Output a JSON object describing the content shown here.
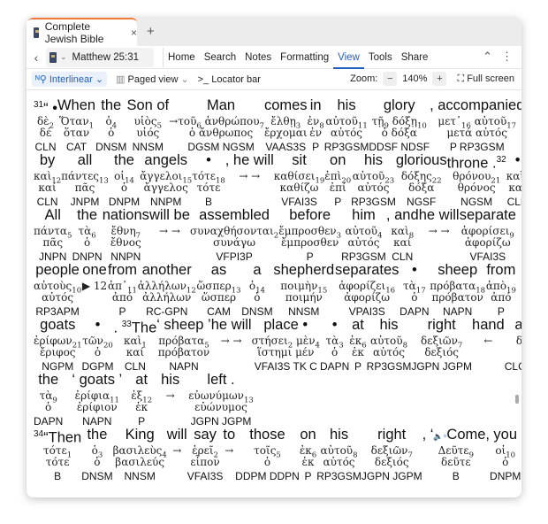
{
  "tab": {
    "title": "Complete Jewish Bible",
    "close": "×",
    "new": "+"
  },
  "nav": {
    "back": "‹",
    "reference": "Matthew 25:31",
    "menu": [
      "Home",
      "Search",
      "Notes",
      "Formatting",
      "View",
      "Tools",
      "Share"
    ],
    "active": "View",
    "collapse": "⌃",
    "more": "⋮"
  },
  "toolbar": {
    "interlinear": "Interlinear",
    "paged": "Paged view",
    "locator": "Locator bar",
    "zoom_label": "Zoom:",
    "zoom_minus": "−",
    "zoom_value": "140%",
    "zoom_plus": "+",
    "fullscreen": "Full screen"
  },
  "accent": "#1f5fbf",
  "rows": [
    {
      "cols": [
        {
          "v": "31",
          "en": "“ •",
          "gk": [
            [
              "δὲ",
              "2"
            ]
          ],
          "lem": "δέ",
          "m": "CLN"
        },
        {
          "en": "When",
          "gk": [
            [
              "Ὅταν",
              "1"
            ]
          ],
          "lem": "ὅταν",
          "m": "CAT"
        },
        {
          "en": "the",
          "gk": [
            [
              "ὁ",
              "4"
            ]
          ],
          "lem": "ὁ",
          "m": "DNSM"
        },
        {
          "en": "Son of",
          "gk": [
            [
              "υἱὸς",
              "5"
            ]
          ],
          "lem": "υἱός",
          "m": "NNSM"
        },
        {
          "en": "",
          "gk": [
            [
              "→",
              ""
            ]
          ],
          "lem": "",
          "m": ""
        },
        {
          "en": "Man",
          "gk": [
            [
              "τοῦ",
              "6"
            ],
            [
              "ἀνθρώπου",
              "7"
            ]
          ],
          "lem": "ὁ ἄνθρωπος",
          "m": "DGSM NGSM"
        },
        {
          "en": "comes",
          "gk": [
            [
              "ἔλθῃ",
              "3"
            ]
          ],
          "lem": "ἔρχομαι",
          "m": "VAAS3S"
        },
        {
          "en": "in",
          "gk": [
            [
              "ἐν",
              "8"
            ]
          ],
          "lem": "ἐν",
          "m": "P"
        },
        {
          "en": "his",
          "gk": [
            [
              "αὐτοῦ",
              "11"
            ]
          ],
          "lem": "αὐτός",
          "m": "RP3GSM"
        },
        {
          "en": "glory",
          "gk": [
            [
              "τῇ",
              "9"
            ],
            [
              "δόξῃ",
              "10"
            ]
          ],
          "lem": "ὁ δόξα",
          "m": "DDSF NDSF"
        },
        {
          "en": ", accompanied",
          "gk": [
            [
              "μετ᾽",
              "16"
            ],
            [
              "αὐτοῦ",
              "17"
            ]
          ],
          "lem": "μετά αὐτός",
          "m": "P RP3GSM"
        }
      ]
    },
    {
      "cols": [
        {
          "en": "by",
          "gk": [
            [
              "καὶ",
              "12"
            ]
          ],
          "lem": "καί",
          "m": "CLN"
        },
        {
          "en": "all",
          "gk": [
            [
              "πάντες",
              "13"
            ]
          ],
          "lem": "πᾶς",
          "m": "JNPM"
        },
        {
          "en": "the",
          "gk": [
            [
              "οἱ",
              "14"
            ]
          ],
          "lem": "ὁ",
          "m": "DNPM"
        },
        {
          "en": "angels",
          "gk": [
            [
              "ἄγγελοι",
              "15"
            ]
          ],
          "lem": "ἄγγελος",
          "m": "NNPM"
        },
        {
          "en": "•",
          "gk": [
            [
              "τότε",
              "18"
            ]
          ],
          "lem": "τότε",
          "m": "B"
        },
        {
          "en": ", he will",
          "gk": [
            [
              "→ →",
              ""
            ]
          ],
          "lem": "",
          "m": ""
        },
        {
          "en": "sit",
          "gk": [
            [
              "καθίσει",
              "19"
            ]
          ],
          "lem": "καθίζω",
          "m": "VFAI3S"
        },
        {
          "en": "on",
          "gk": [
            [
              "ἐπὶ",
              "20"
            ]
          ],
          "lem": "ἐπί",
          "m": "P"
        },
        {
          "en": "his",
          "gk": [
            [
              "αὐτοῦ",
              "23"
            ]
          ],
          "lem": "αὐτός",
          "m": "RP3GSM"
        },
        {
          "en": "glorious",
          "gk": [
            [
              "δόξης",
              "22"
            ]
          ],
          "lem": "δόξα",
          "m": "NGSF"
        },
        {
          "en": "throne .",
          "v2": "32",
          "gk": [
            [
              "θρόνου",
              "21"
            ]
          ],
          "lem": "θρόνος",
          "m": "NGSM"
        },
        {
          "en": "•",
          "gk": [
            [
              "καὶ",
              "1"
            ]
          ],
          "lem": "καί",
          "m": "CLN"
        }
      ]
    },
    {
      "cols": [
        {
          "en": "All",
          "gk": [
            [
              "πάντα",
              "5"
            ]
          ],
          "lem": "πᾶς",
          "m": "JNPN"
        },
        {
          "en": "the",
          "gk": [
            [
              "τὰ",
              "6"
            ]
          ],
          "lem": "ὁ",
          "m": "DNPN"
        },
        {
          "en": "nations",
          "gk": [
            [
              "ἔθνη",
              "7"
            ]
          ],
          "lem": "ἔθνος",
          "m": "NNPN"
        },
        {
          "en": "will be",
          "gk": [
            [
              "→ →",
              ""
            ]
          ],
          "lem": "",
          "m": ""
        },
        {
          "en": "assembled",
          "gk": [
            [
              "συναχθήσονται",
              "2"
            ]
          ],
          "lem": "συνάγω",
          "m": "VFPI3P"
        },
        {
          "en": "before",
          "gk": [
            [
              "ἔμπροσθεν",
              "3"
            ]
          ],
          "lem": "ἔμπροσθεν",
          "m": "P"
        },
        {
          "en": "him",
          "gk": [
            [
              "αὐτοῦ",
              "4"
            ]
          ],
          "lem": "αὐτός",
          "m": "RP3GSM"
        },
        {
          "en": ", and",
          "gk": [
            [
              "καὶ",
              "8"
            ]
          ],
          "lem": "καί",
          "m": "CLN"
        },
        {
          "en": "he will",
          "gk": [
            [
              "→ →",
              ""
            ]
          ],
          "lem": "",
          "m": ""
        },
        {
          "en": "separate",
          "gk": [
            [
              "ἀφορίσει",
              "9"
            ]
          ],
          "lem": "ἀφορίζω",
          "m": "VFAI3S"
        }
      ]
    },
    {
      "cols": [
        {
          "en": "people",
          "gk": [
            [
              "αὐτοὺς",
              "10"
            ]
          ],
          "lem": "αὐτός",
          "m": "RP3APM"
        },
        {
          "en": "one",
          "gk": [
            [
              "▶ 12",
              ""
            ]
          ],
          "lem": "",
          "m": ""
        },
        {
          "en": "from",
          "gk": [
            [
              "ἀπ᾽",
              "11"
            ]
          ],
          "lem": "ἀπό",
          "m": "P"
        },
        {
          "en": "another",
          "gk": [
            [
              "ἀλλήλων",
              "12"
            ]
          ],
          "lem": "ἀλλήλων",
          "m": "RC-GPN"
        },
        {
          "en": "as",
          "gk": [
            [
              "ὥσπερ",
              "13"
            ]
          ],
          "lem": "ὥσπερ",
          "m": "CAM"
        },
        {
          "en": "a",
          "gk": [
            [
              "ὁ",
              "14"
            ]
          ],
          "lem": "ὁ",
          "m": "DNSM"
        },
        {
          "en": "shepherd",
          "gk": [
            [
              "ποιμὴν",
              "15"
            ]
          ],
          "lem": "ποιμήν",
          "m": "NNSM"
        },
        {
          "en": "separates",
          "gk": [
            [
              "ἀφορίζει",
              "16"
            ]
          ],
          "lem": "ἀφορίζω",
          "m": "VPAI3S"
        },
        {
          "en": "•",
          "gk": [
            [
              "τὰ",
              "17"
            ]
          ],
          "lem": "ὁ",
          "m": "DAPN"
        },
        {
          "en": "sheep",
          "gk": [
            [
              "πρόβατα",
              "18"
            ]
          ],
          "lem": "πρόβατον",
          "m": "NAPN"
        },
        {
          "en": "from",
          "gk": [
            [
              "ἀπὸ",
              "19"
            ]
          ],
          "lem": "ἀπό",
          "m": "P"
        }
      ]
    },
    {
      "cols": [
        {
          "en": "goats",
          "gk": [
            [
              "ἐρίφων",
              "21"
            ]
          ],
          "lem": "ἔριφος",
          "m": "NGPM"
        },
        {
          "en": "•",
          "gk": [
            [
              "τῶν",
              "20"
            ]
          ],
          "lem": "ὁ",
          "m": "DGPM"
        },
        {
          "en": ". ",
          "v2": "33",
          "en2": "The",
          "gk": [
            [
              "καὶ",
              "1"
            ]
          ],
          "lem": "καί",
          "m": "CLN"
        },
        {
          "en": "‘ sheep ’",
          "gk": [
            [
              "πρόβατα",
              "5"
            ]
          ],
          "lem": "πρόβατον",
          "m": "NAPN"
        },
        {
          "en": "he will",
          "gk": [
            [
              "→ →",
              ""
            ]
          ],
          "lem": "",
          "m": ""
        },
        {
          "en": "place •",
          "gk": [
            [
              "στήσει",
              "2"
            ],
            [
              "μὲν",
              "4"
            ]
          ],
          "lem": "ἵστημι μέν",
          "m": "VFAI3S TK C"
        },
        {
          "en": "•",
          "gk": [
            [
              "τὰ",
              "3"
            ]
          ],
          "lem": "ὁ",
          "m": "DAPN"
        },
        {
          "en": "at",
          "gk": [
            [
              "ἐκ",
              "6"
            ]
          ],
          "lem": "ἐκ",
          "m": "P"
        },
        {
          "en": "his",
          "gk": [
            [
              "αὐτοῦ",
              "8"
            ]
          ],
          "lem": "αὐτός",
          "m": "RP3GSM"
        },
        {
          "en": "right",
          "gk": [
            [
              "δεξιῶν",
              "7"
            ]
          ],
          "lem": "δεξιός",
          "m": "JGPN JGPM"
        },
        {
          "en": "hand",
          "gk": [
            [
              "←",
              ""
            ]
          ],
          "lem": "",
          "m": ""
        },
        {
          "en": "and",
          "gk": [
            [
              "δὲ",
              "10"
            ]
          ],
          "lem": "δέ",
          "m": "CLC CLK"
        }
      ]
    },
    {
      "left": true,
      "cols": [
        {
          "en": "the",
          "gk": [
            [
              "τὰ",
              "9"
            ]
          ],
          "lem": "ὁ",
          "m": "DAPN"
        },
        {
          "en": "‘ goats ’",
          "gk": [
            [
              "ἐρίφια",
              "11"
            ]
          ],
          "lem": "ἐρίφιον",
          "m": "NAPN"
        },
        {
          "en": "at",
          "gk": [
            [
              "ἐξ",
              "12"
            ]
          ],
          "lem": "ἐκ",
          "m": "P"
        },
        {
          "en": "his",
          "gk": [
            [
              "→",
              ""
            ]
          ],
          "lem": "",
          "m": ""
        },
        {
          "en": "left      .",
          "gk": [
            [
              "εὐωνύμων",
              "13"
            ]
          ],
          "lem": "εὐώνυμος",
          "m": "JGPN JGPM"
        }
      ]
    },
    {
      "cols": [
        {
          "v": "34",
          "en": "“Then",
          "gk": [
            [
              "τότε",
              "1"
            ]
          ],
          "lem": "τότε",
          "m": "B"
        },
        {
          "en": "the",
          "gk": [
            [
              "ὁ",
              "3"
            ]
          ],
          "lem": "ὁ",
          "m": "DNSM"
        },
        {
          "en": "King",
          "gk": [
            [
              "βασιλεὺς",
              "4"
            ]
          ],
          "lem": "βασιλεύς",
          "m": "NNSM"
        },
        {
          "en": "will",
          "gk": [
            [
              "→",
              ""
            ]
          ],
          "lem": "",
          "m": ""
        },
        {
          "en": "say",
          "gk": [
            [
              "ἐρεῖ",
              "2"
            ]
          ],
          "lem": "εἶπον",
          "m": "VFAI3S"
        },
        {
          "en": "to",
          "gk": [
            [
              "→",
              ""
            ]
          ],
          "lem": "",
          "m": ""
        },
        {
          "en": "those",
          "gk": [
            [
              "τοῖς",
              "5"
            ]
          ],
          "lem": "ὁ",
          "m": "DDPM DDPN"
        },
        {
          "en": "on",
          "gk": [
            [
              "ἐκ",
              "6"
            ]
          ],
          "lem": "ἐκ",
          "m": "P"
        },
        {
          "en": "his",
          "gk": [
            [
              "αὐτοῦ",
              "8"
            ]
          ],
          "lem": "αὐτός",
          "m": "RP3GSM"
        },
        {
          "en": "right",
          "gk": [
            [
              "δεξιῶν",
              "7"
            ]
          ],
          "lem": "δεξιός",
          "m": "JGPN JGPM"
        },
        {
          "en": ", ‘",
          "icons": "🔈⁸",
          "en2": "Come,",
          "gk": [
            [
              "Δεῦτε",
              "9"
            ]
          ],
          "lem": "δεῦτε",
          "m": "B"
        },
        {
          "en": "you",
          "gk": [
            [
              "οἱ",
              "10"
            ]
          ],
          "lem": "ὁ",
          "m": "DNPM"
        }
      ]
    }
  ]
}
